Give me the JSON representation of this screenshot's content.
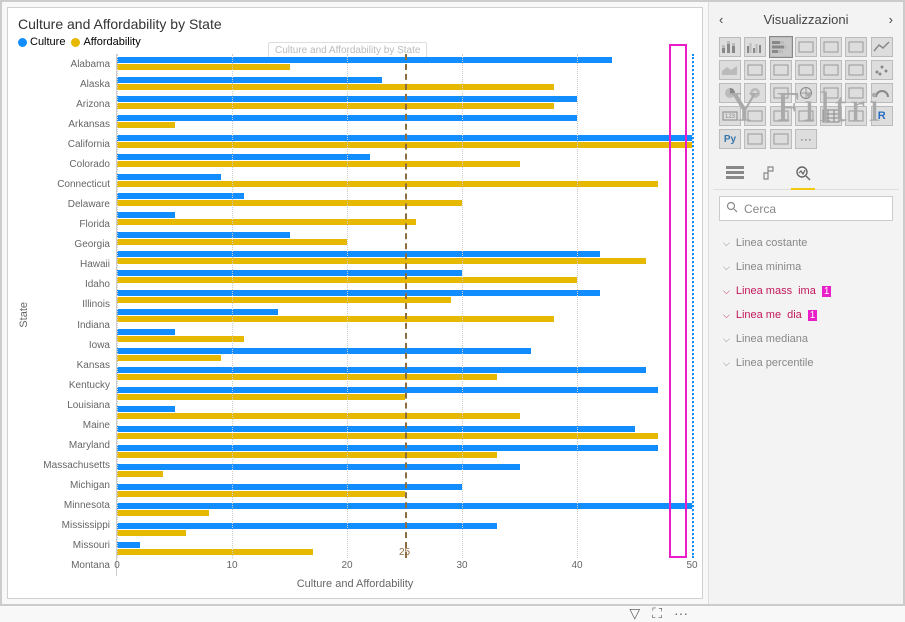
{
  "chart": {
    "title": "Culture and Affordability by State",
    "ghost_title": "Culture and Affordability by State",
    "legend": [
      {
        "label": "Culture",
        "color": "#118dff"
      },
      {
        "label": "Affordability",
        "color": "#e6b800"
      }
    ],
    "yaxis": "State",
    "xaxis": "Culture and Affordability",
    "xticks": [
      "0",
      "10",
      "20",
      "30",
      "40",
      "50"
    ],
    "ref_mean": {
      "value": 25,
      "label": "25",
      "color": "#8b6d3f"
    },
    "ref_max": {
      "value": 50,
      "color": "#118dff"
    }
  },
  "chart_data": {
    "type": "bar",
    "orientation": "horizontal",
    "xlabel": "Culture and Affordability",
    "ylabel": "State",
    "xlim": [
      0,
      50
    ],
    "categories": [
      "Alabama",
      "Alaska",
      "Arizona",
      "Arkansas",
      "California",
      "Colorado",
      "Connecticut",
      "Delaware",
      "Florida",
      "Georgia",
      "Hawaii",
      "Idaho",
      "Illinois",
      "Indiana",
      "Iowa",
      "Kansas",
      "Kentucky",
      "Louisiana",
      "Maine",
      "Maryland",
      "Massachusetts",
      "Michigan",
      "Minnesota",
      "Mississippi",
      "Missouri",
      "Montana"
    ],
    "series": [
      {
        "name": "Culture",
        "color": "#118dff",
        "values": [
          43,
          23,
          40,
          40,
          50,
          22,
          9,
          11,
          5,
          15,
          42,
          30,
          42,
          14,
          5,
          36,
          46,
          47,
          5,
          45,
          47,
          35,
          30,
          50,
          33,
          2
        ]
      },
      {
        "name": "Affordability",
        "color": "#e6b800",
        "values": [
          15,
          38,
          38,
          5,
          50,
          35,
          47,
          30,
          26,
          20,
          46,
          40,
          29,
          38,
          11,
          9,
          33,
          25,
          35,
          47,
          33,
          4,
          25,
          8,
          6,
          17
        ]
      }
    ]
  },
  "panel": {
    "title": "Visualizzazioni",
    "watermark": "Y Filtri",
    "search_placeholder": "Cerca",
    "tabs": {
      "fields": "⊞",
      "format": "🖌",
      "analytics": "⊕"
    },
    "accordions": [
      {
        "label": "Linea costante",
        "pink": false,
        "count": ""
      },
      {
        "label": "Linea minima",
        "pink": false,
        "count": ""
      },
      {
        "label": "Linea massima",
        "pink": true,
        "count": "1"
      },
      {
        "label": "Linea media",
        "pink": true,
        "count": "1"
      },
      {
        "label": "Linea mediana",
        "pink": false,
        "count": ""
      },
      {
        "label": "Linea percentile",
        "pink": false,
        "count": ""
      }
    ],
    "viz_types": [
      "stacked-bar",
      "clustered-bar",
      "stacked-bar-h",
      "clustered-bar-h",
      "stacked-100",
      "clustered-100",
      "line",
      "area",
      "stacked-area",
      "line-bar",
      "line-bar2",
      "ribbon",
      "waterfall",
      "scatter",
      "pie",
      "donut",
      "treemap",
      "map",
      "filled-map",
      "funnel",
      "gauge",
      "card",
      "multi-card",
      "kpi",
      "slicer",
      "table",
      "matrix",
      "r-visual",
      "py-visual",
      "key-influencer",
      "decomposition",
      "more"
    ]
  },
  "actions": {
    "filter": "▽",
    "focus": "⛶",
    "more": "···"
  }
}
